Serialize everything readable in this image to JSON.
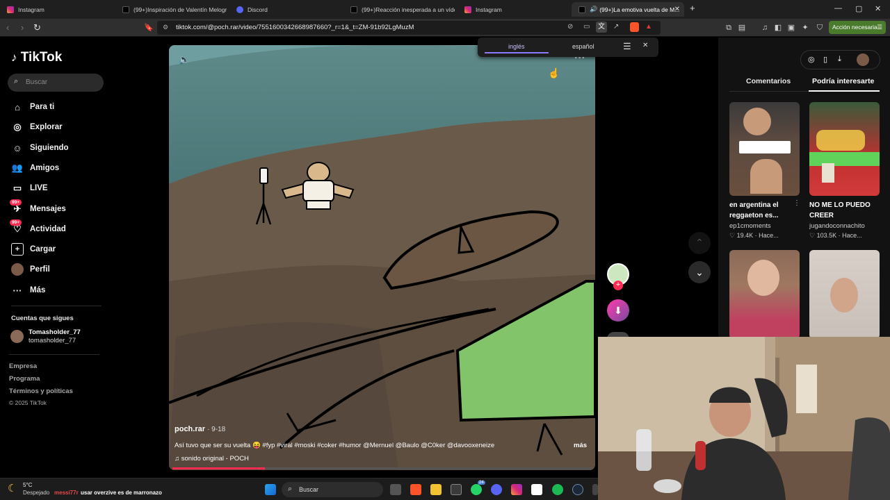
{
  "browser": {
    "tabs": [
      {
        "label": "Instagram"
      },
      {
        "label": "(99+)Inspiración de Valentín Melogr..."
      },
      {
        "label": "Discord"
      },
      {
        "label": "(99+)Reacción inesperada a un vídeo..."
      },
      {
        "label": "Instagram"
      },
      {
        "label": "(99+)La emotiva vuelta de M..."
      }
    ],
    "url": "tiktok.com/@poch.rar/video/7551600342668987660?_r=1&_t=ZM-91b92LgMuzM",
    "action_button": "Acción necesaria"
  },
  "translate": {
    "source_lang": "inglés",
    "target_lang": "español"
  },
  "sidebar": {
    "logo": "TikTok",
    "search_placeholder": "Buscar",
    "items": [
      {
        "label": "Para ti",
        "icon": "home-icon"
      },
      {
        "label": "Explorar",
        "icon": "compass-icon"
      },
      {
        "label": "Siguiendo",
        "icon": "following-icon"
      },
      {
        "label": "Amigos",
        "icon": "friends-icon"
      },
      {
        "label": "LIVE",
        "icon": "live-icon"
      },
      {
        "label": "Mensajes",
        "icon": "messages-icon",
        "badge": "99+"
      },
      {
        "label": "Actividad",
        "icon": "activity-icon",
        "badge": "99+"
      },
      {
        "label": "Cargar",
        "icon": "upload-icon"
      },
      {
        "label": "Perfil",
        "icon": "profile-avatar"
      },
      {
        "label": "Más",
        "icon": "more-icon"
      }
    ],
    "following_title": "Cuentas que sigues",
    "following_user": {
      "display": "Tomasholder_77",
      "handle": "tomasholder_77"
    },
    "footer": [
      "Empresa",
      "Programa",
      "Términos y políticas",
      "© 2025 TikTok"
    ]
  },
  "video": {
    "author": "poch.rar",
    "date": "· 9-18",
    "caption": "Así tuvo que ser su vuelta 😝 #fyp #viral #moski #coker #humor @Mernuel @Baulo @C0ker @davooxeneize",
    "more": "más",
    "sound": "sonido original - POCH",
    "progress": 0.22
  },
  "right_panel": {
    "tabs": [
      "Comentarios",
      "Podría interesarte"
    ],
    "active_tab": 1,
    "cards": [
      {
        "title_lines": [
          "en argentina el",
          "reggaeton es..."
        ],
        "user": "ep1cmoments",
        "likes": "19.4K",
        "time": "Hace..."
      },
      {
        "title_lines": [
          "NO ME LO PUEDO",
          "CREER"
        ],
        "user": "jugandoconnachito",
        "likes": "103.5K",
        "time": "Hace..."
      }
    ]
  },
  "taskbar": {
    "weather_temp": "5°C",
    "weather_desc": "Despejado",
    "notif_user": "messi77r",
    "notif_text": "usar overzive es de marronazo",
    "search": "Buscar",
    "discord_badge": "24"
  },
  "colors": {
    "accent": "#fe2c55",
    "action_green": "#4a7a2c",
    "translate_underline": "#8b7bff"
  }
}
